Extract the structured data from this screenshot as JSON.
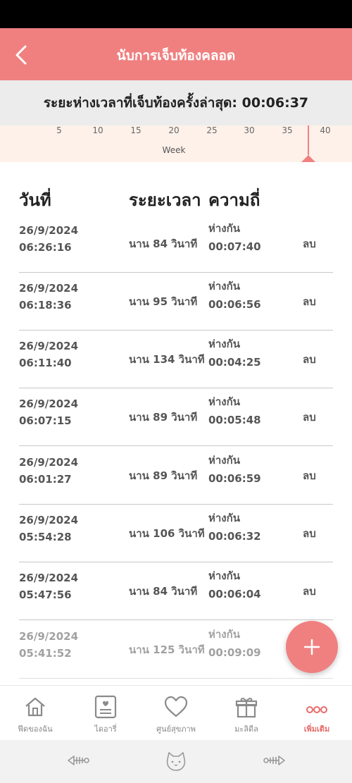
{
  "header": {
    "title": "นับการเจ็บท้องคลอด",
    "back_icon": "chevron-left-icon"
  },
  "last_interval": {
    "label": "ระยะห่างเวลาที่เจ็บท้องครั้งล่าสุด:",
    "value": "00:06:37"
  },
  "week_axis": {
    "ticks": [
      "5",
      "10",
      "15",
      "20",
      "25",
      "30",
      "35",
      "40"
    ],
    "label": "Week",
    "marker_week": 39
  },
  "table": {
    "headers": {
      "date": "วันที่",
      "duration": "ระยะเวลา",
      "frequency": "ความถี่"
    },
    "rows": [
      {
        "date": "26/9/2024",
        "time": "06:26:16",
        "duration": "นาน 84 วินาที",
        "freq_label": "ห่างกัน",
        "freq_value": "00:07:40",
        "delete": "ลบ"
      },
      {
        "date": "26/9/2024",
        "time": "06:18:36",
        "duration": "นาน 95 วินาที",
        "freq_label": "ห่างกัน",
        "freq_value": "00:06:56",
        "delete": "ลบ"
      },
      {
        "date": "26/9/2024",
        "time": "06:11:40",
        "duration": "นาน 134 วินาที",
        "freq_label": "ห่างกัน",
        "freq_value": "00:04:25",
        "delete": "ลบ"
      },
      {
        "date": "26/9/2024",
        "time": "06:07:15",
        "duration": "นาน 89 วินาที",
        "freq_label": "ห่างกัน",
        "freq_value": "00:05:48",
        "delete": "ลบ"
      },
      {
        "date": "26/9/2024",
        "time": "06:01:27",
        "duration": "นาน 89 วินาที",
        "freq_label": "ห่างกัน",
        "freq_value": "00:06:59",
        "delete": "ลบ"
      },
      {
        "date": "26/9/2024",
        "time": "05:54:28",
        "duration": "นาน 106 วินาที",
        "freq_label": "ห่างกัน",
        "freq_value": "00:06:32",
        "delete": "ลบ"
      },
      {
        "date": "26/9/2024",
        "time": "05:47:56",
        "duration": "นาน 84 วินาที",
        "freq_label": "ห่างกัน",
        "freq_value": "00:06:04",
        "delete": "ลบ"
      },
      {
        "date": "26/9/2024",
        "time": "05:41:52",
        "duration": "นาน 125 วินาที",
        "freq_label": "ห่างกัน",
        "freq_value": "00:09:09",
        "delete": ""
      }
    ]
  },
  "fab": {
    "icon": "plus-icon"
  },
  "bottom_nav": [
    {
      "label": "ฟีดของฉัน",
      "icon": "home-icon",
      "active": false
    },
    {
      "label": "ไดอารี่",
      "icon": "diary-icon",
      "active": false
    },
    {
      "label": "ศูนย์สุขภาพ",
      "icon": "heart-icon",
      "active": false
    },
    {
      "label": "มะลิดีล",
      "icon": "gift-icon",
      "active": false
    },
    {
      "label": "เพิ่มเติม",
      "icon": "more-icon",
      "active": true
    }
  ],
  "colors": {
    "accent": "#f08080",
    "active_nav": "#e86b6b",
    "band": "#ececec",
    "axis_bg": "#fdf1ea"
  }
}
